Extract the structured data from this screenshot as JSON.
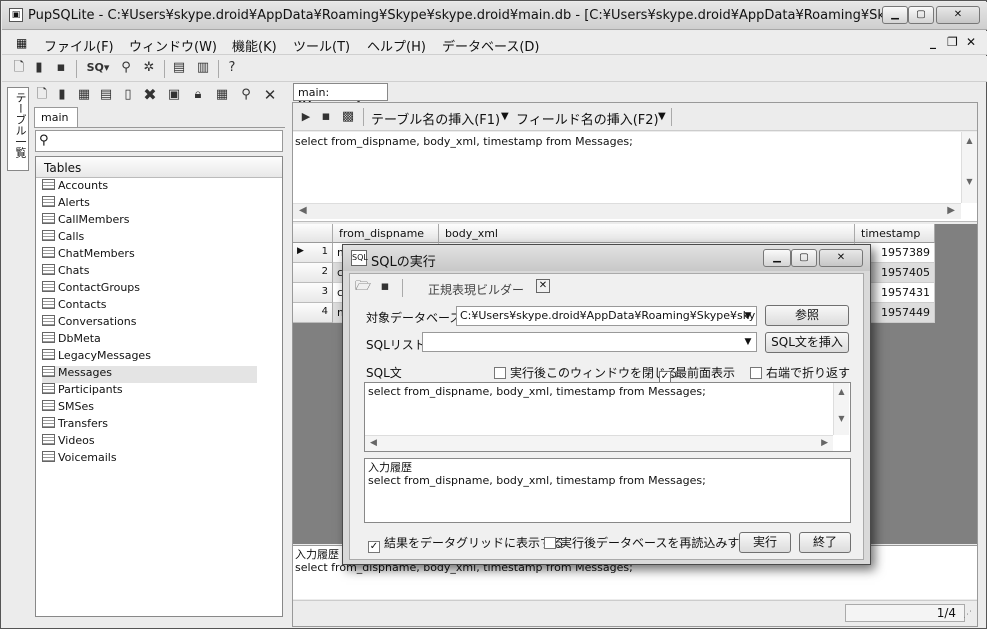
{
  "window": {
    "title": "PupSQLite - C:¥Users¥skype.droid¥AppData¥Roaming¥Skype¥skype.droid¥main.db - [C:¥Users¥skype.droid¥AppData¥Roaming¥Skype¥sky..."
  },
  "menu": [
    "ファイル(F)",
    "ウィンドウ(W)",
    "機能(K)",
    "ツール(T)",
    "ヘルプ(H)",
    "データベース(D)"
  ],
  "side": {
    "vertical_tab": "テーブル一覧",
    "db_tab": "main",
    "tree_header": "Tables",
    "tables": [
      "Accounts",
      "Alerts",
      "CallMembers",
      "Calls",
      "ChatMembers",
      "Chats",
      "ContactGroups",
      "Contacts",
      "Conversations",
      "DbMeta",
      "LegacyMessages",
      "Messages",
      "Participants",
      "SMSes",
      "Transfers",
      "Videos",
      "Voicemails"
    ],
    "selected": "Messages"
  },
  "doc": {
    "tab": "main: [Messages]",
    "insert_table": "テーブル名の挿入(F1)",
    "insert_field": "フィールド名の挿入(F2)",
    "query": "select from_dispname, body_xml, timestamp from Messages;",
    "columns": [
      "from_dispname",
      "body_xml",
      "timestamp"
    ],
    "rows": [
      {
        "n": "1",
        "a": "m",
        "ts": "1957389"
      },
      {
        "n": "2",
        "a": "c",
        "ts": "1957405"
      },
      {
        "n": "3",
        "a": "c",
        "ts": "1957431"
      },
      {
        "n": "4",
        "a": "m",
        "ts": "1957449"
      }
    ],
    "history_label": "入力履歴",
    "history_text": "select from_dispname, body_xml, timestamp from Messages;",
    "page": "1/4"
  },
  "dialog": {
    "title": "SQLの実行",
    "regex_builder": "正規表現ビルダー",
    "target_db_label": "対象データベース",
    "target_db_value": "C:¥Users¥skype.droid¥AppData¥Roaming¥Skype¥skype",
    "browse": "参照",
    "sql_list_label": "SQLリスト",
    "insert_sql": "SQL文を挿入",
    "sql_label": "SQL文",
    "close_after": "実行後このウィンドウを閉じる",
    "topmost": "最前面表示",
    "wrap": "右端で折り返す",
    "sql_text": "select from_dispname, body_xml, timestamp from Messages;",
    "history_label": "入力履歴",
    "history_text": "select from_dispname, body_xml, timestamp from Messages;",
    "show_in_grid": "結果をデータグリッドに表示する",
    "reload_after": "実行後データベースを再読込みする",
    "run": "実行",
    "end": "終了"
  }
}
